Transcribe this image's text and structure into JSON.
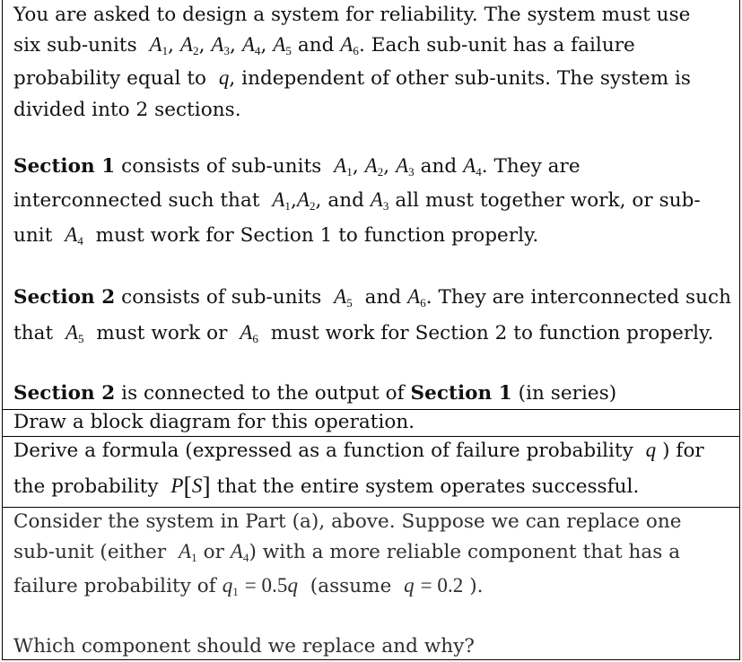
{
  "intro": {
    "line1": "You are asked to design a system for reliability.  The system must use",
    "line2_pre": "six sub-units",
    "units_all": [
      "A",
      "A",
      "A",
      "A",
      "A",
      "A"
    ],
    "subs_all": [
      "1",
      "2",
      "3",
      "4",
      "5",
      "6"
    ],
    "line2_and": "and",
    "line2_post": ". Each sub-unit has a failure",
    "line3_pre": "probability equal to",
    "q": "q",
    "line3_post": ", independent of other sub-units. The system is",
    "line4": "divided into 2 sections."
  },
  "section1": {
    "title": "Section 1",
    "line1_pre": " consists of sub-units",
    "line1_and": "and",
    "line1_post": ". They are",
    "line2_pre": "interconnected such that",
    "line2_and": "and",
    "line2_post": "all must together work, or sub-",
    "line3_pre": "unit",
    "line3_post": "must work for Section 1 to function properly."
  },
  "section2": {
    "title": "Section 2",
    "line1_pre": " consists of sub-units",
    "line1_and": "and",
    "line1_post": ". They are interconnected such",
    "line2_pre": "that",
    "line2_mid": "must work or",
    "line2_post": "must work for Section 2 to function properly."
  },
  "series": {
    "s2": "Section 2",
    "mid": " is connected to the output of ",
    "s1": "Section 1",
    "post": " (in series)"
  },
  "part_a": {
    "text": "Draw a block diagram for this operation."
  },
  "part_b": {
    "line1_pre": "Derive a formula (expressed as a function of failure probability",
    "line1_post": ") for",
    "line2_pre": "the probability",
    "P": "P",
    "S": "S",
    "line2_post": "that the entire system operates successful."
  },
  "part_c": {
    "line1": "Consider the system in Part (a), above. Suppose we can replace one",
    "line2_pre": "sub-unit (either",
    "line2_or": "or",
    "line2_post": ") with a more reliable component that has a",
    "line3_pre": "failure probability of",
    "q1_eq": "= 0.5",
    "assume_pre": "(assume",
    "q_eq": "= 0.2",
    "assume_post": ").",
    "question": "Which component should we replace and why?"
  }
}
